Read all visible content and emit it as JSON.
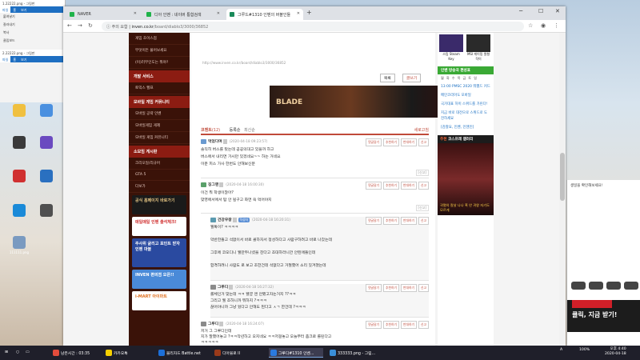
{
  "desktop": {
    "icons": [
      "",
      "",
      "",
      "",
      "",
      "",
      "",
      "",
      "111111.png"
    ],
    "bgwin": {
      "title": "1.22222.png - 그림판",
      "tabs": [
        "파일",
        "홈",
        "보기"
      ],
      "rows": [
        "붙여넣기",
        "잘라내기",
        "복사",
        "클립보드"
      ],
      "title2": "2.22222.png - 그림판"
    },
    "right_text": "생일을 확인해보세요!",
    "right_ad": "클릭, 지금 받기!"
  },
  "browser": {
    "tabs": [
      {
        "label": "NAVER",
        "active": false
      },
      {
        "label": "디아 인벤 : 네이버 통합검색",
        "active": false
      },
      {
        "label": "그루드#1310 인벤의 버블인들",
        "active": true
      }
    ],
    "url": {
      "warning": "주의 요함",
      "domain": "inven.co.kr",
      "path": "/board/diablo3/3000/36852"
    }
  },
  "leftnav": {
    "top_items": [
      "게임 초이스점",
      "무엇이든 물어보세요",
      "(이)러무인도는 뭐야?"
    ],
    "sections": [
      {
        "title": "개발 서비스",
        "items": [
          "토익스 헬프"
        ]
      },
      {
        "title": "모바일 게임 커뮤니티",
        "items": [
          "모바일 공략 인벤",
          "모바일게임 게제",
          "모바일 게임 커뮤니티"
        ]
      },
      {
        "title": "소모임 게시판",
        "items": [
          "크리오일/리규어",
          "GTA 5",
          "다보가"
        ]
      }
    ],
    "banners": [
      "공식 홈페이지 바로가기",
      "매일매일 인벤 출석체크!",
      "주사위 굴리고 포인트 받자 인벤 마블",
      "INVEN 편의점 오픈!!",
      "i-MART 아이마트"
    ]
  },
  "content": {
    "source_url": "http://www.inven.co.kr/board/diablo3/3000/36852",
    "buttons": [
      "목록",
      "글쓰기"
    ],
    "comment_header": {
      "label": "코멘트",
      "count": "(12)",
      "sort": "등록순",
      "sort2": "최신순",
      "refresh": "새로고침"
    },
    "comments": [
      {
        "nick": "먹었다며",
        "date": "(2020-04-18 09:23:57)",
        "body": "솔직히 버스를 탔는데 공공의대고 있을까 하고\n버스에서 내리면 가시만 있겠네요~~ 하는 거네요\n이분 피스 가사 한번도 안해보신분"
      },
      {
        "nick": "징그맨",
        "date": "(2020-04-18 16:00:30)",
        "body": "이건 뭐 학생이잖아?\n맞영에서에서 탐 안 될구고 화면 쏙 먹어야지"
      },
      {
        "nick": "건강우왕",
        "badge": "작성자",
        "date": "(2020-04-18 16:20:31)",
        "body": "웰톡이? ㅋㅋㅋㅋ\n\n막반한들고 석없이서 바로 콜하자서 정성하다고 사람구하려고 바로 나갔는데\n\n그후에 코오디니 웰만두나셨을 찬다고 조대하라니깐 안된애들인데\n\n합격하려니 사람도 로 보고 조한건데  석없다고 거절했어 소리 짓겨졌는데"
      },
      {
        "nick": "그루디",
        "date": "(2020-04-18 16:27:32)",
        "body": "롤체인거 맞는데 ㅋㅋ 웰궁 앤 안됐고자는거지 ??ㅋㅋ\n그리고 웰 조하니까 뭐하지 ?ㅋㅋㅋ\n끊어야니까 그냥 뒀다고 안해도 된다고 ㅅㄱ 한건데 ?ㅋㅋㅋ"
      },
      {
        "nick": "그루디",
        "date": "(2020-04-18 16:24:07)",
        "body": "저거 그 그루디인데\n지가 말했어놓고 ?ㅋㅋ작년하고 오지네요 ㅋㅋ저걸놓고 오늘부터 좀크로 롤린다고\nㅋㅋㅋㅋㅋ"
      }
    ],
    "comment_buttons": [
      "댓글달기",
      "추천하기",
      "반대하기",
      "신고"
    ],
    "report_label": "[신고]"
  },
  "rightcol": {
    "top_ads": [
      "스팀 Steam Key",
      "MSI 게이밍 원형작이"
    ],
    "streamer_title": "인벤 방송국 편성표",
    "days": [
      "월",
      "화",
      "수",
      "목",
      "금",
      "토",
      "일"
    ],
    "streamer_list": [
      "13:00 PMSC 2020 뭐했드 커드",
      "메인코리아도 모바일",
      "국가대표 하이 스위드를 가린다!",
      "지금 바로 대전으로 스위드로 도전하세요",
      "[감찰요, 인벤, 인젠인]"
    ],
    "gallery_title_prefix": "추천",
    "gallery_title": "코스프레 갤러리",
    "gallery_caption": "귀멸의 칼날 나나 혹 안 귀왕 자기도 모르게"
  },
  "taskbar": {
    "items": [
      {
        "label": "남은시간 : 03:35",
        "color": "#e34c3c"
      },
      {
        "label": "카카오톡",
        "color": "#f7d000"
      },
      {
        "label": "블리자드 Battle.net",
        "color": "#1c6fd8"
      },
      {
        "label": "디아블로 II",
        "color": "#9a3a1a"
      },
      {
        "label": "그루디#1310 인벤...",
        "color": "#2a7ae0",
        "active": true
      },
      {
        "label": "333333.png - 그림...",
        "color": "#3a8fd9"
      }
    ],
    "tray": {
      "ime": "A",
      "zoom": "100%",
      "time": "오후 4:40",
      "date": "2020-04-18"
    }
  }
}
